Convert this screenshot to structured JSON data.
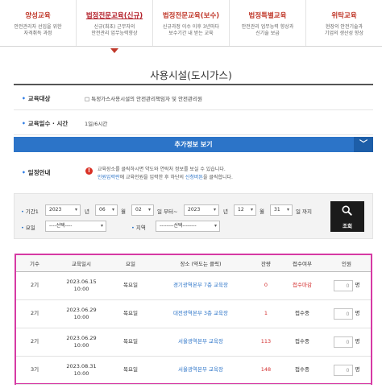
{
  "tabs": [
    {
      "title": "양성교육",
      "desc": "안전관리자 선임을 위한\n자격취득 과정",
      "active": false
    },
    {
      "title": "법정전문교육(신규)",
      "desc": "신규(최초) 근무자의\n안전관리 업무능력향상",
      "active": true
    },
    {
      "title": "법정전문교육(보수)",
      "desc": "신규과정 이수 이후 3년마다\n보수기간 내 받는 교육",
      "active": false
    },
    {
      "title": "법정특별교육",
      "desc": "안전관리 업무능력 향상과\n신기술 보급",
      "active": false
    },
    {
      "title": "위탁교육",
      "desc": "현장의 안전기술과\n기업의 생산성 향상",
      "active": false
    }
  ],
  "page": {
    "title": "사용시설(도시가스)"
  },
  "info": {
    "target_label": "교육대상",
    "target_value": "□ 특정가스사용시설의 안전관리책임자 및 안전관리원",
    "duration_label": "교육일수 · 시간",
    "duration_value": "1일/6시간",
    "more_label": "추가정보 보기",
    "more_chevron": "﹀",
    "schedule_label": "일정안내",
    "notice_icon": "!",
    "notice_line1": "교육장소를 클릭하시면 약도와 연락처 정보를 보실 수 있습니다.",
    "notice_line2_blue1": "인원입력란",
    "notice_line2_mid": "에 교육인원을 입력한 후 하단의 ",
    "notice_line2_blue2": "신청버튼",
    "notice_line2_end": "을 클릭합니다."
  },
  "search": {
    "period_label": "기간1",
    "y1": "2023",
    "y1_unit": "년",
    "m1": "06",
    "m1_unit": "월",
    "d1": "02",
    "d1_unit": "일 부터~",
    "y2": "2023",
    "y2_unit": "년",
    "m2": "12",
    "m2_unit": "월",
    "d2": "31",
    "d2_unit": "일 까지",
    "day_label": "요일",
    "day_value": "----선택----",
    "region_label": "지역",
    "region_value": "--------선택--------",
    "button_label": "조회"
  },
  "table": {
    "headers": [
      "기수",
      "교육일시",
      "요일",
      "장소 (약도는 클릭)",
      "잔량",
      "접수여부",
      "인원"
    ],
    "rows": [
      {
        "term": "2기",
        "date": "2023.06.15",
        "time": "10:00",
        "weekday": "목요일",
        "place": "경기광역본부 7층 교육장",
        "remain": "0",
        "status": "접수마감",
        "qty": "0",
        "unit": "명"
      },
      {
        "term": "2기",
        "date": "2023.06.29",
        "time": "10:00",
        "weekday": "목요일",
        "place": "대전광역본부 3층 교육장",
        "remain": "1",
        "status": "접수중",
        "qty": "0",
        "unit": "명"
      },
      {
        "term": "2기",
        "date": "2023.06.29",
        "time": "10:00",
        "weekday": "목요일",
        "place": "서울광역본부 교육장",
        "remain": "113",
        "status": "접수중",
        "qty": "0",
        "unit": "명"
      },
      {
        "term": "3기",
        "date": "2023.08.31",
        "time": "10:00",
        "weekday": "목요일",
        "place": "서울광역본부 교육장",
        "remain": "148",
        "status": "접수중",
        "qty": "0",
        "unit": "명"
      }
    ]
  }
}
